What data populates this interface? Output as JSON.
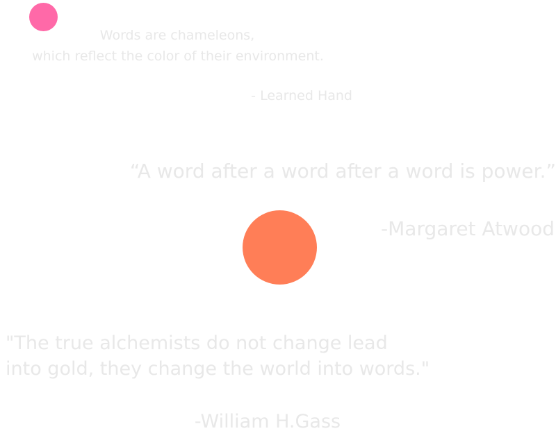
{
  "quotes": [
    {
      "lines": [
        "Words are chameleons,",
        "which reflect the color of their environment."
      ],
      "author": "- Learned Hand"
    },
    {
      "lines": [
        "“A word  after a word after a word is power.”"
      ],
      "author": "-Margaret Atwood"
    },
    {
      "lines": [
        "\"The true alchemists do not change lead",
        "into gold, they change the world into words.\""
      ],
      "author": "-William H.Gass"
    }
  ],
  "decorations": {
    "pink_dot_color": "#ff69a8",
    "orange_dot_color": "#ff7e57",
    "text_color": "#e8e8e8"
  }
}
